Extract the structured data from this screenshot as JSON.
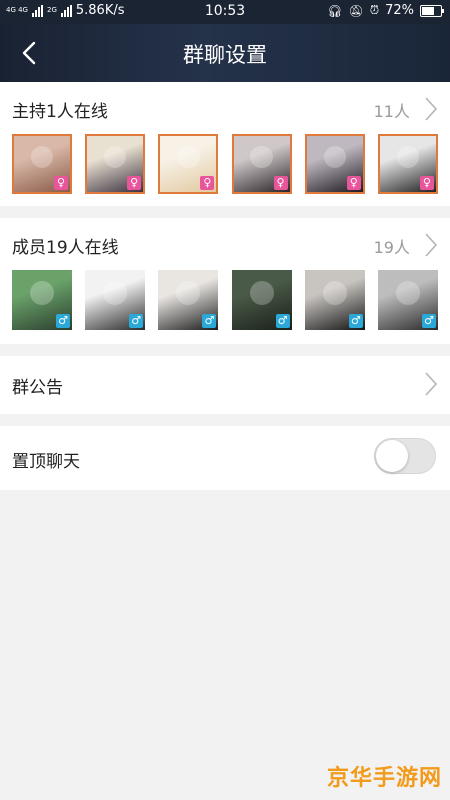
{
  "status_bar": {
    "network_small": "4G 4G",
    "network_small_2": "2G",
    "speed": "5.86K/s",
    "time": "10:53",
    "battery": "72%",
    "battery_level": 0.72
  },
  "nav": {
    "title": "群聊设置"
  },
  "hosts": {
    "title": "主持1人在线",
    "count": "11人",
    "avatars": [
      {
        "gender": "female",
        "gender_symbol": "♀",
        "colors": [
          "#d9b8a8",
          "#8a5a48"
        ]
      },
      {
        "gender": "female",
        "gender_symbol": "♀",
        "colors": [
          "#e8e0d0",
          "#3a3040"
        ]
      },
      {
        "gender": "female",
        "gender_symbol": "♀",
        "colors": [
          "#f7f1e6",
          "#e2c9a0"
        ]
      },
      {
        "gender": "female",
        "gender_symbol": "♀",
        "colors": [
          "#cfc7c8",
          "#2b2528"
        ]
      },
      {
        "gender": "female",
        "gender_symbol": "♀",
        "colors": [
          "#bfb8c0",
          "#1e1a22"
        ]
      },
      {
        "gender": "female",
        "gender_symbol": "♀",
        "colors": [
          "#e6e6e6",
          "#202020"
        ]
      }
    ]
  },
  "members": {
    "title": "成员19人在线",
    "count": "19人",
    "avatars": [
      {
        "gender": "male",
        "gender_symbol": "♂",
        "colors": [
          "#6aa26a",
          "#2b3e2e"
        ]
      },
      {
        "gender": "male",
        "gender_symbol": "♂",
        "colors": [
          "#f2f2f2",
          "#2a2a2a"
        ]
      },
      {
        "gender": "male",
        "gender_symbol": "♂",
        "colors": [
          "#e9e6e2",
          "#1c1c1c"
        ]
      },
      {
        "gender": "male",
        "gender_symbol": "♂",
        "colors": [
          "#4a5a48",
          "#1a201a"
        ]
      },
      {
        "gender": "male",
        "gender_symbol": "♂",
        "colors": [
          "#c8c4c0",
          "#141414"
        ]
      },
      {
        "gender": "male",
        "gender_symbol": "♂",
        "colors": [
          "#bdbdbd",
          "#2a2a2a"
        ]
      }
    ]
  },
  "announcement": {
    "label": "群公告"
  },
  "pin_chat": {
    "label": "置顶聊天",
    "enabled": false
  },
  "watermark": "京华手游网",
  "colors": {
    "navbar": "#1d2638",
    "host_border": "#e07a3c",
    "female_badge": "#e9559a",
    "male_badge": "#2aa9d8",
    "toggle_off": "#e4e4e4"
  }
}
